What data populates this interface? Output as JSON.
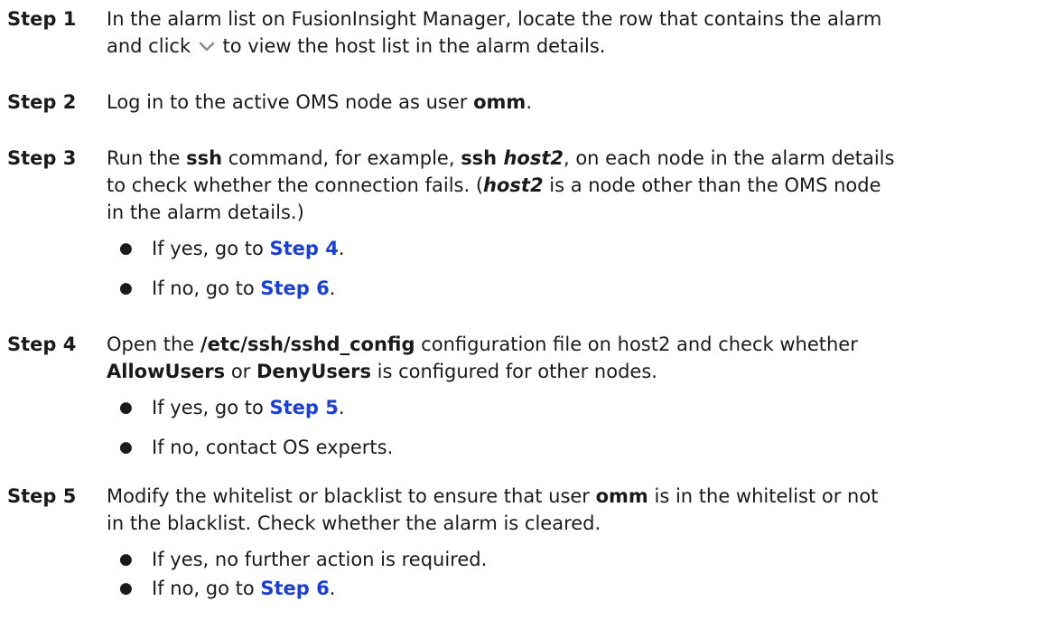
{
  "steps": [
    {
      "label": "Step 1",
      "text_a": "In the alarm list on FusionInsight Manager, locate the row that contains the alarm",
      "text_b": "and click ",
      "icon": "chevron-down-icon",
      "text_c": " to view the host list in the alarm details."
    },
    {
      "label": "Step 2",
      "text_a": "Log in to the active OMS node as user ",
      "bold_a": "omm",
      "text_b": "."
    },
    {
      "label": "Step 3",
      "text_a": "Run the ",
      "bold_a": "ssh",
      "text_b": " command, for example, ",
      "bold_b": "ssh ",
      "bolditalic_a": "host2",
      "text_c": ", on each node in the alarm details",
      "text_d": "to check whether the connection fails. (",
      "bolditalic_b": "host2",
      "text_e": " is a node other than the OMS node",
      "text_f": "in the alarm details.)",
      "bullets": [
        {
          "dot": "●",
          "prefix": "If yes, go to ",
          "link": "Step 4",
          "suffix": "."
        },
        {
          "dot": "●",
          "prefix": "If no, go to ",
          "link": "Step 6",
          "suffix": "."
        }
      ]
    },
    {
      "label": "Step 4",
      "text_a": "Open the ",
      "bold_a": "/etc/ssh/sshd_config",
      "text_b": " configuration file on host2 and check whether",
      "bold_b": "AllowUsers",
      "text_c": " or ",
      "bold_c": "DenyUsers",
      "text_d": " is configured for other nodes.",
      "bullets": [
        {
          "dot": "●",
          "prefix": "If yes, go to ",
          "link": "Step 5",
          "suffix": "."
        },
        {
          "dot": "●",
          "prefix": "If no, contact OS experts.",
          "link": "",
          "suffix": ""
        }
      ]
    },
    {
      "label": "Step 5",
      "text_a": "Modify the whitelist or blacklist to ensure that user ",
      "bold_a": "omm",
      "text_b": " is in the whitelist or not",
      "text_c": "in the blacklist. Check whether the alarm is cleared.",
      "bullets": [
        {
          "dot": "●",
          "prefix": "If yes, no further action is required.",
          "link": "",
          "suffix": ""
        },
        {
          "dot": "●",
          "prefix": "If no, go to ",
          "link": "Step 6",
          "suffix": "."
        }
      ]
    }
  ],
  "colors": {
    "link": "#1a3fd6",
    "text": "#1a1a1a",
    "chevron": "#8c8c8c"
  }
}
